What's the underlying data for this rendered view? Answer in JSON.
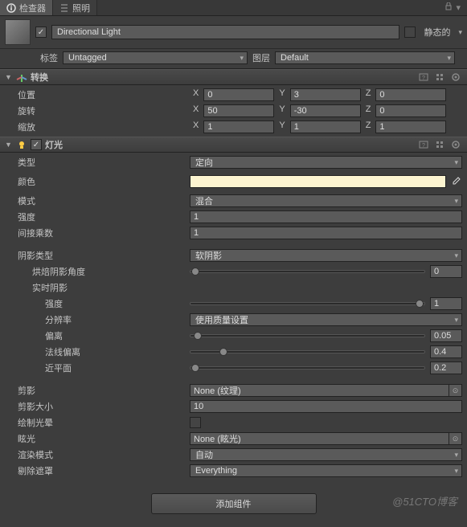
{
  "tabs": {
    "inspector": "检查器",
    "lighting": "照明"
  },
  "header": {
    "name": "Directional Light",
    "static_label": "静态的",
    "tag_label": "标签",
    "tag_value": "Untagged",
    "layer_label": "图层",
    "layer_value": "Default"
  },
  "transform": {
    "title": "转换",
    "rows": {
      "position": {
        "label": "位置",
        "x": "0",
        "y": "3",
        "z": "0"
      },
      "rotation": {
        "label": "旋转",
        "x": "50",
        "y": "-30",
        "z": "0"
      },
      "scale": {
        "label": "缩放",
        "x": "1",
        "y": "1",
        "z": "1"
      }
    },
    "axis": {
      "x": "X",
      "y": "Y",
      "z": "Z"
    }
  },
  "light": {
    "title": "灯光",
    "type_label": "类型",
    "type_value": "定向",
    "color_label": "颜色",
    "color_value": "#fcf4d0",
    "mode_label": "模式",
    "mode_value": "混合",
    "intensity_label": "强度",
    "intensity_value": "1",
    "indirect_label": "间接乘数",
    "indirect_value": "1",
    "shadow_type_label": "阴影类型",
    "shadow_type_value": "软阴影",
    "baked_angle_label": "烘焙阴影角度",
    "baked_angle_value": "0",
    "realtime_label": "实时阴影",
    "rt_strength_label": "强度",
    "rt_strength_value": "1",
    "rt_res_label": "分辨率",
    "rt_res_value": "使用质量设置",
    "rt_bias_label": "偏离",
    "rt_bias_value": "0.05",
    "rt_normal_label": "法线偏离",
    "rt_normal_value": "0.4",
    "rt_near_label": "近平面",
    "rt_near_value": "0.2",
    "cookie_label": "剪影",
    "cookie_value": "None (纹理)",
    "cookie_size_label": "剪影大小",
    "cookie_size_value": "10",
    "halo_label": "绘制光晕",
    "flare_label": "眩光",
    "flare_value": "None (眩光)",
    "render_mode_label": "渲染模式",
    "render_mode_value": "自动",
    "culling_label": "剔除遮罩",
    "culling_value": "Everything"
  },
  "add_component": "添加组件",
  "watermark": "@51CTO博客"
}
